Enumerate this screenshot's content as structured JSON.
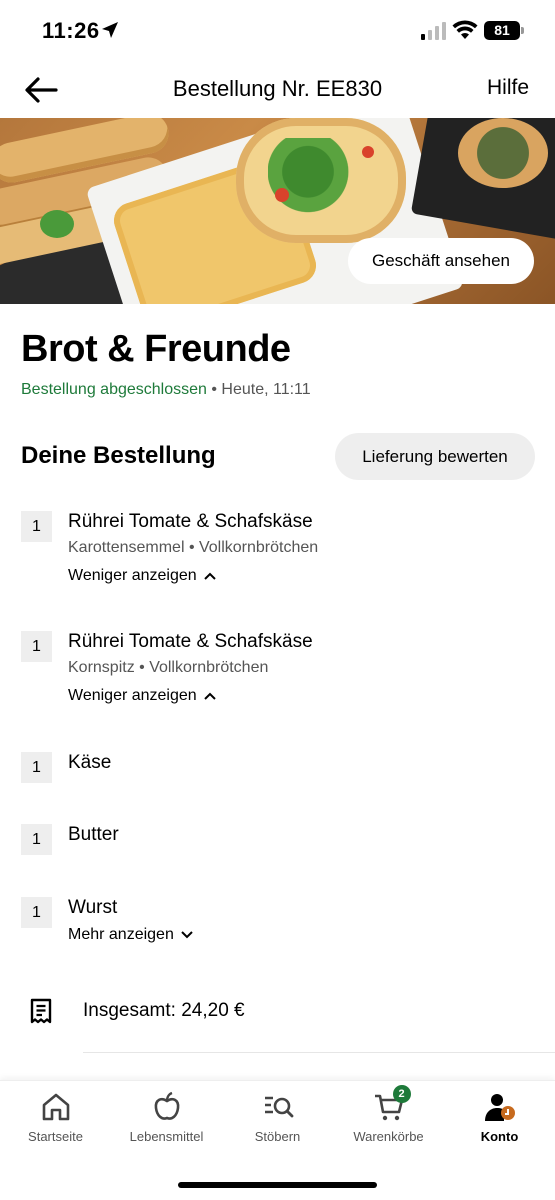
{
  "status_bar": {
    "time": "11:26",
    "battery": "81"
  },
  "header": {
    "title": "Bestellung Nr. EE830",
    "help_label": "Hilfe"
  },
  "hero": {
    "shop_button": "Geschäft ansehen"
  },
  "store": {
    "name": "Brot & Freunde",
    "status": "Bestellung abgeschlossen",
    "separator": " • ",
    "time": "Heute, 11:11"
  },
  "order": {
    "title": "Deine Bestellung",
    "rate_button": "Lieferung bewerten",
    "items": [
      {
        "qty": "1",
        "name": "Rührei Tomate & Schafskäse",
        "options": "Karottensemmel • Vollkornbrötchen",
        "toggle": "Weniger anzeigen"
      },
      {
        "qty": "1",
        "name": "Rührei Tomate & Schafskäse",
        "options": "Kornspitz • Vollkornbrötchen",
        "toggle": "Weniger anzeigen"
      },
      {
        "qty": "1",
        "name": "Käse"
      },
      {
        "qty": "1",
        "name": "Butter"
      },
      {
        "qty": "1",
        "name": "Wurst",
        "toggle": "Mehr anzeigen"
      }
    ],
    "total": "Insgesamt: 24,20 €"
  },
  "tabbar": {
    "tabs": [
      {
        "label": "Startseite",
        "icon": "home-icon"
      },
      {
        "label": "Lebensmittel",
        "icon": "apple-icon"
      },
      {
        "label": "Stöbern",
        "icon": "browse-search-icon"
      },
      {
        "label": "Warenkörbe",
        "icon": "cart-icon",
        "badge": "2"
      },
      {
        "label": "Konto",
        "icon": "account-icon",
        "active": true
      }
    ]
  },
  "colors": {
    "accent_green": "#1e7a3a",
    "chip_gray": "#eeeeee"
  }
}
